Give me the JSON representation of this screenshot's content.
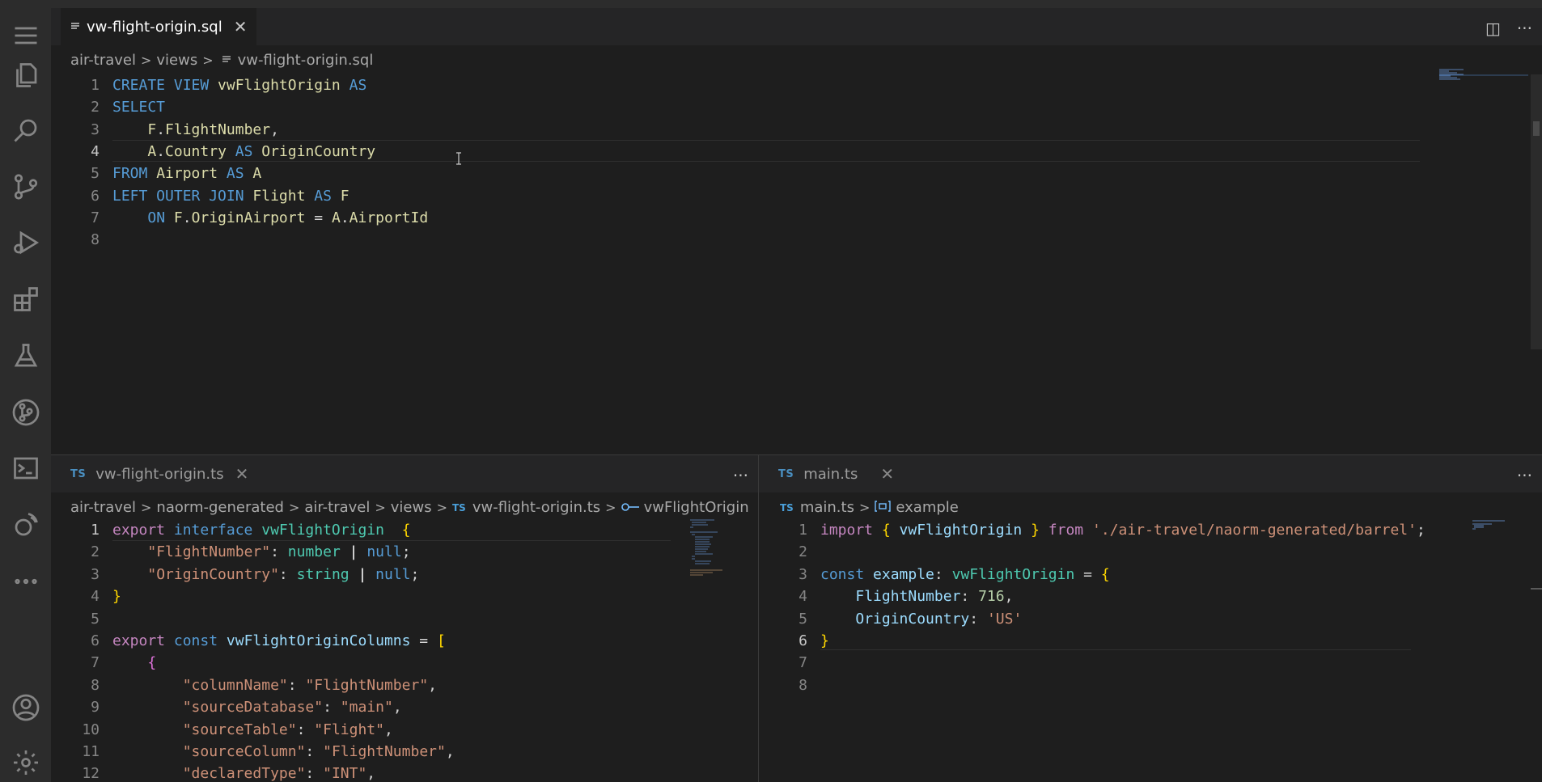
{
  "top_editor": {
    "tab_label": "vw-flight-origin.sql",
    "breadcrumb": [
      "air-travel",
      "views",
      "vw-flight-origin.sql"
    ],
    "lines": [
      {
        "n": "1",
        "parts": [
          [
            "kw",
            "CREATE VIEW "
          ],
          [
            "id",
            "vwFlightOrigin"
          ],
          [
            "kw",
            " AS"
          ]
        ]
      },
      {
        "n": "2",
        "parts": [
          [
            "kw",
            "SELECT"
          ]
        ]
      },
      {
        "n": "3",
        "parts": [
          [
            "plain",
            "    "
          ],
          [
            "id",
            "F"
          ],
          [
            "plain",
            "."
          ],
          [
            "id",
            "FlightNumber"
          ],
          [
            "plain",
            ","
          ]
        ]
      },
      {
        "n": "4",
        "parts": [
          [
            "plain",
            "    "
          ],
          [
            "id",
            "A"
          ],
          [
            "plain",
            "."
          ],
          [
            "id",
            "Country"
          ],
          [
            "kw",
            " AS "
          ],
          [
            "id",
            "OriginCountry"
          ]
        ]
      },
      {
        "n": "5",
        "parts": [
          [
            "kw",
            "FROM "
          ],
          [
            "id",
            "Airport"
          ],
          [
            "kw",
            " AS "
          ],
          [
            "id",
            "A"
          ]
        ]
      },
      {
        "n": "6",
        "parts": [
          [
            "kw",
            "LEFT OUTER JOIN "
          ],
          [
            "id",
            "Flight"
          ],
          [
            "kw",
            " AS "
          ],
          [
            "id",
            "F"
          ]
        ]
      },
      {
        "n": "7",
        "parts": [
          [
            "plain",
            "    "
          ],
          [
            "kw",
            "ON "
          ],
          [
            "id",
            "F"
          ],
          [
            "plain",
            "."
          ],
          [
            "id",
            "OriginAirport"
          ],
          [
            "plain",
            " = "
          ],
          [
            "id",
            "A"
          ],
          [
            "plain",
            "."
          ],
          [
            "id",
            "AirportId"
          ]
        ]
      },
      {
        "n": "8",
        "parts": []
      }
    ]
  },
  "left_editor": {
    "tab_label": "vw-flight-origin.ts",
    "tab_lang": "TS",
    "breadcrumb": [
      "air-travel",
      "naorm-generated",
      "air-travel",
      "views",
      "vw-flight-origin.ts",
      "vwFlightOrigin"
    ],
    "lines": [
      {
        "n": "1",
        "parts": [
          [
            "ctl",
            "export "
          ],
          [
            "kw",
            "interface "
          ],
          [
            "typ",
            "vwFlightOrigin"
          ],
          [
            "plain",
            "  "
          ],
          [
            "brk",
            "{"
          ]
        ]
      },
      {
        "n": "2",
        "parts": [
          [
            "plain",
            "    "
          ],
          [
            "str",
            "\"FlightNumber\""
          ],
          [
            "plain",
            ": "
          ],
          [
            "typ",
            "number"
          ],
          [
            "plain",
            " "
          ],
          [
            "wht",
            "|"
          ],
          [
            "plain",
            " "
          ],
          [
            "kw",
            "null"
          ],
          [
            "plain",
            ";"
          ]
        ]
      },
      {
        "n": "3",
        "parts": [
          [
            "plain",
            "    "
          ],
          [
            "str",
            "\"OriginCountry\""
          ],
          [
            "plain",
            ": "
          ],
          [
            "typ",
            "string"
          ],
          [
            "plain",
            " "
          ],
          [
            "wht",
            "|"
          ],
          [
            "plain",
            " "
          ],
          [
            "kw",
            "null"
          ],
          [
            "plain",
            ";"
          ]
        ]
      },
      {
        "n": "4",
        "parts": [
          [
            "brk",
            "}"
          ]
        ]
      },
      {
        "n": "5",
        "parts": []
      },
      {
        "n": "6",
        "parts": [
          [
            "ctl",
            "export "
          ],
          [
            "kw",
            "const "
          ],
          [
            "fld",
            "vwFlightOriginColumns"
          ],
          [
            "plain",
            " = "
          ],
          [
            "brk",
            "["
          ]
        ]
      },
      {
        "n": "7",
        "parts": [
          [
            "plain",
            "    "
          ],
          [
            "brk2",
            "{"
          ]
        ]
      },
      {
        "n": "8",
        "parts": [
          [
            "plain",
            "        "
          ],
          [
            "str",
            "\"columnName\""
          ],
          [
            "plain",
            ": "
          ],
          [
            "str",
            "\"FlightNumber\""
          ],
          [
            "plain",
            ","
          ]
        ]
      },
      {
        "n": "9",
        "parts": [
          [
            "plain",
            "        "
          ],
          [
            "str",
            "\"sourceDatabase\""
          ],
          [
            "plain",
            ": "
          ],
          [
            "str",
            "\"main\""
          ],
          [
            "plain",
            ","
          ]
        ]
      },
      {
        "n": "10",
        "parts": [
          [
            "plain",
            "        "
          ],
          [
            "str",
            "\"sourceTable\""
          ],
          [
            "plain",
            ": "
          ],
          [
            "str",
            "\"Flight\""
          ],
          [
            "plain",
            ","
          ]
        ]
      },
      {
        "n": "11",
        "parts": [
          [
            "plain",
            "        "
          ],
          [
            "str",
            "\"sourceColumn\""
          ],
          [
            "plain",
            ": "
          ],
          [
            "str",
            "\"FlightNumber\""
          ],
          [
            "plain",
            ","
          ]
        ]
      },
      {
        "n": "12",
        "parts": [
          [
            "plain",
            "        "
          ],
          [
            "str",
            "\"declaredType\""
          ],
          [
            "plain",
            ": "
          ],
          [
            "str",
            "\"INT\""
          ],
          [
            "plain",
            ","
          ]
        ]
      }
    ]
  },
  "right_editor": {
    "tab_label": "main.ts",
    "tab_lang": "TS",
    "breadcrumb": [
      "main.ts",
      "example"
    ],
    "lines": [
      {
        "n": "1",
        "parts": [
          [
            "ctl",
            "import "
          ],
          [
            "brk",
            "{ "
          ],
          [
            "fld",
            "vwFlightOrigin"
          ],
          [
            "brk",
            " }"
          ],
          [
            "ctl",
            " from "
          ],
          [
            "str",
            "'./air-travel/naorm-generated/barrel'"
          ],
          [
            "plain",
            ";"
          ]
        ]
      },
      {
        "n": "2",
        "parts": []
      },
      {
        "n": "3",
        "parts": [
          [
            "kw",
            "const "
          ],
          [
            "fld",
            "example"
          ],
          [
            "plain",
            ": "
          ],
          [
            "typ",
            "vwFlightOrigin"
          ],
          [
            "plain",
            " = "
          ],
          [
            "brk",
            "{"
          ]
        ]
      },
      {
        "n": "4",
        "parts": [
          [
            "plain",
            "    "
          ],
          [
            "fld",
            "FlightNumber"
          ],
          [
            "plain",
            ": "
          ],
          [
            "num",
            "716"
          ],
          [
            "plain",
            ","
          ]
        ]
      },
      {
        "n": "5",
        "parts": [
          [
            "plain",
            "    "
          ],
          [
            "fld",
            "OriginCountry"
          ],
          [
            "plain",
            ": "
          ],
          [
            "str",
            "'US'"
          ]
        ]
      },
      {
        "n": "6",
        "parts": [
          [
            "brk",
            "}"
          ]
        ]
      },
      {
        "n": "7",
        "parts": []
      },
      {
        "n": "8",
        "parts": []
      }
    ]
  },
  "icons": [
    "menu-icon",
    "explorer-icon",
    "search-icon",
    "source-control-icon",
    "run-debug-icon",
    "extensions-icon",
    "testing-icon",
    "git-graph-icon",
    "terminal-icon",
    "remote-icon",
    "more-icon",
    "account-icon",
    "settings-icon"
  ],
  "glyphs": {
    "close": "✕",
    "ellipsis": "···",
    "split": "◫"
  }
}
